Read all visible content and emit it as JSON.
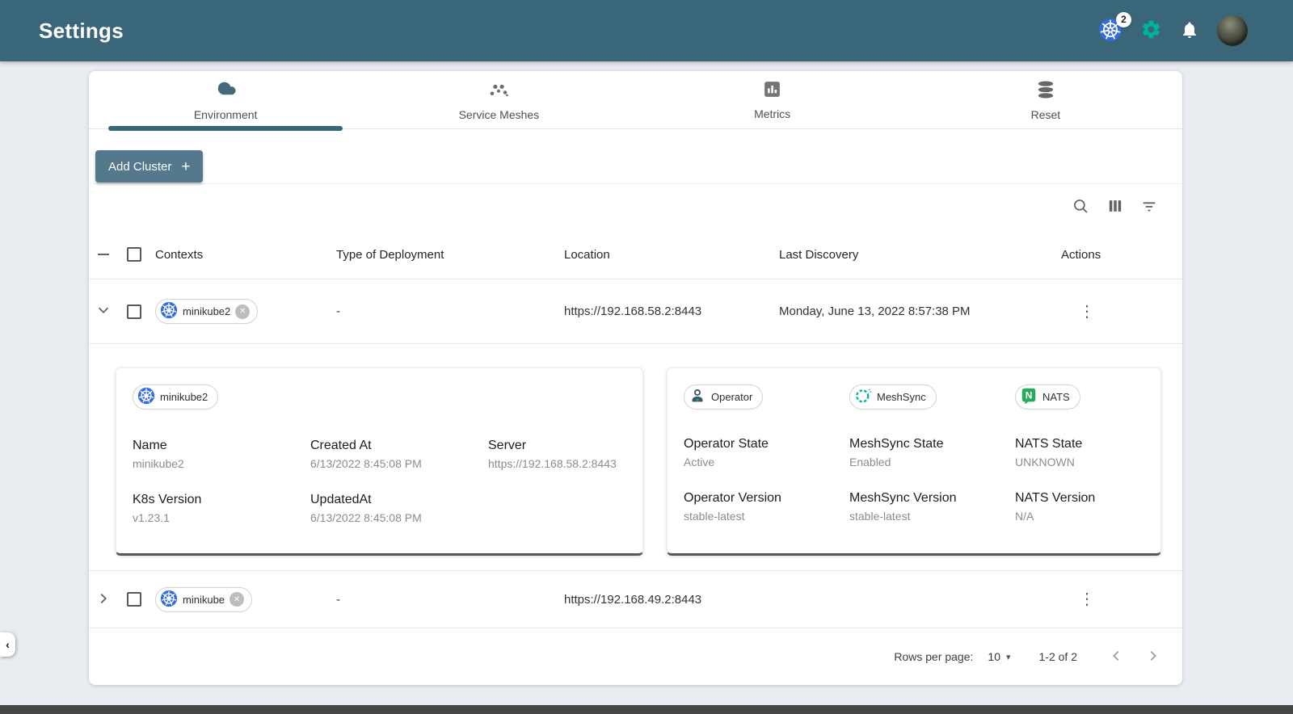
{
  "header": {
    "title": "Settings",
    "k8s_badge": "2"
  },
  "tabs": [
    {
      "label": "Environment",
      "active": true
    },
    {
      "label": "Service Meshes",
      "active": false
    },
    {
      "label": "Metrics",
      "active": false
    },
    {
      "label": "Reset",
      "active": false
    }
  ],
  "add_cluster": {
    "label": "Add Cluster"
  },
  "table": {
    "columns": [
      "Contexts",
      "Type of Deployment",
      "Location",
      "Last Discovery",
      "Actions"
    ],
    "rows": [
      {
        "context": "minikube2",
        "type": "-",
        "location": "https://192.168.58.2:8443",
        "last_discovery": "Monday, June 13, 2022 8:57:38 PM",
        "expanded": true
      },
      {
        "context": "minikube",
        "type": "-",
        "location": "https://192.168.49.2:8443",
        "last_discovery": "",
        "expanded": false
      }
    ]
  },
  "details": {
    "chip": "minikube2",
    "fields": [
      {
        "label": "Name",
        "value": "minikube2"
      },
      {
        "label": "Created At",
        "value": "6/13/2022 8:45:08 PM"
      },
      {
        "label": "Server",
        "value": "https://192.168.58.2:8443"
      },
      {
        "label": "K8s Version",
        "value": "v1.23.1"
      },
      {
        "label": "UpdatedAt",
        "value": "6/13/2022 8:45:08 PM"
      }
    ]
  },
  "operator": {
    "chips": [
      "Operator",
      "MeshSync",
      "NATS"
    ],
    "fields": [
      {
        "label": "Operator State",
        "value": "Active"
      },
      {
        "label": "MeshSync State",
        "value": "Enabled"
      },
      {
        "label": "NATS State",
        "value": "UNKNOWN"
      },
      {
        "label": "Operator Version",
        "value": "stable-latest"
      },
      {
        "label": "MeshSync Version",
        "value": "stable-latest"
      },
      {
        "label": "NATS Version",
        "value": "N/A"
      }
    ]
  },
  "pagination": {
    "rows_per_page_label": "Rows per page:",
    "rows_per_page": "10",
    "range": "1-2 of 2"
  },
  "icons": {
    "close_glyph": "✕",
    "kebab_glyph": "⋮",
    "caret_glyph": "▾",
    "collapse_glyph": "‹",
    "plus_glyph": "+"
  },
  "colors": {
    "appbar_bg": "#396679",
    "tab_indicator": "#396679",
    "add_button": "#54788c",
    "accent_green": "#00B39F",
    "kubernetes_blue": "#326CE5",
    "nats_green": "#27AA5B",
    "page_bg": "#e9edf1"
  }
}
